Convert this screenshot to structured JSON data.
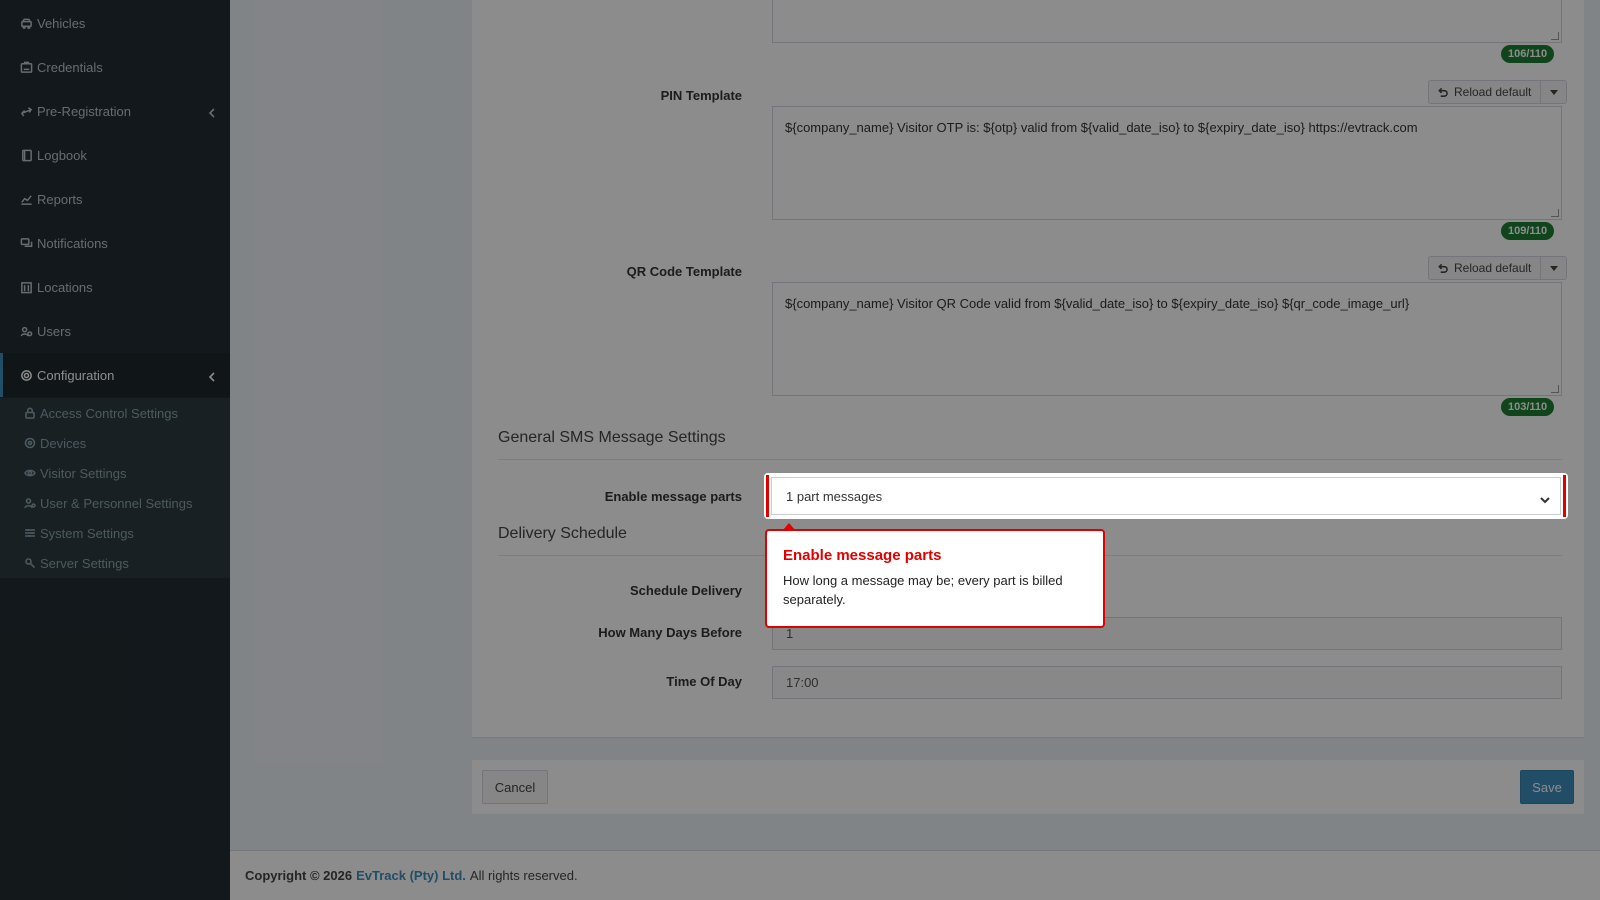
{
  "sidebar": {
    "items": [
      {
        "label": "Vehicles",
        "icon": "car-icon"
      },
      {
        "label": "Credentials",
        "icon": "id-card-icon"
      },
      {
        "label": "Pre-Registration",
        "icon": "exchange-icon",
        "has_chevron": true
      },
      {
        "label": "Logbook",
        "icon": "book-icon"
      },
      {
        "label": "Reports",
        "icon": "chart-icon"
      },
      {
        "label": "Notifications",
        "icon": "comments-icon"
      },
      {
        "label": "Locations",
        "icon": "building-icon"
      },
      {
        "label": "Users",
        "icon": "users-icon"
      },
      {
        "label": "Configuration",
        "icon": "gear-icon",
        "has_chevron": true,
        "active": true
      }
    ],
    "submenu": [
      {
        "label": "Access Control Settings",
        "icon": "lock-icon"
      },
      {
        "label": "Devices",
        "icon": "device-icon"
      },
      {
        "label": "Visitor Settings",
        "icon": "eye-icon"
      },
      {
        "label": "User & Personnel Settings",
        "icon": "user-cog-icon"
      },
      {
        "label": "System Settings",
        "icon": "sliders-icon"
      },
      {
        "label": "Server Settings",
        "icon": "server-cog-icon"
      }
    ]
  },
  "form": {
    "top_counter": "106/110",
    "pin_template": {
      "label": "PIN Template",
      "reload_label": "Reload default",
      "value": "${company_name} Visitor OTP is: ${otp} valid from ${valid_date_iso} to ${expiry_date_iso} https://evtrack.com",
      "counter": "109/110"
    },
    "qr_template": {
      "label": "QR Code Template",
      "reload_label": "Reload default",
      "value": "${company_name} Visitor QR Code valid from ${valid_date_iso} to ${expiry_date_iso} ${qr_code_image_url}",
      "counter": "103/110"
    },
    "general_sms_title": "General SMS Message Settings",
    "enable_parts": {
      "label": "Enable message parts",
      "value": "1 part messages"
    },
    "delivery_title": "Delivery Schedule",
    "schedule_delivery_label": "Schedule Delivery",
    "days_before": {
      "label": "How Many Days Before",
      "value": "1"
    },
    "time_of_day": {
      "label": "Time Of Day",
      "value": "17:00"
    }
  },
  "actions": {
    "cancel": "Cancel",
    "save": "Save"
  },
  "footer": {
    "copyright": "Copyright © 2026",
    "company": "EvTrack (Pty) Ltd.",
    "rights": "All rights reserved."
  },
  "tooltip": {
    "title": "Enable message parts",
    "body": "How long a message may be; every part is billed separately."
  },
  "colors": {
    "sidebar_bg": "#222d32",
    "accent": "#3c8dbc",
    "counter_bg": "#1e7e34",
    "tooltip_border": "#e00000"
  }
}
